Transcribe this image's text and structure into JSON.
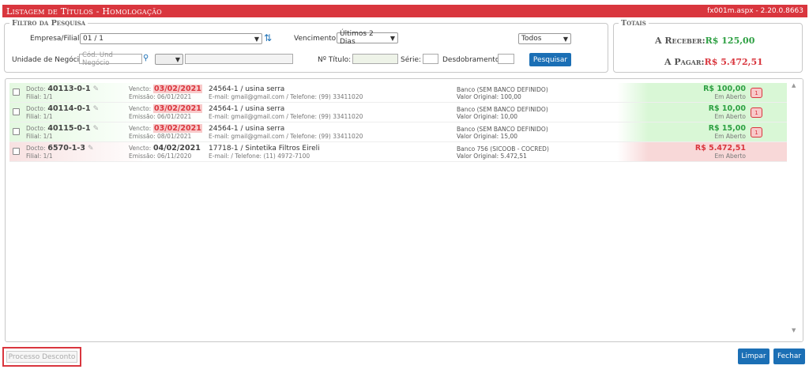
{
  "header": {
    "title": "Listagem de Títulos  - Homologação",
    "version": "fx001m.aspx - 2.20.0.8663"
  },
  "filtro": {
    "legend": "Filtro da Pesquisa",
    "empresa_label": "Empresa/Filial:",
    "empresa_value": "01 / 1",
    "vencimento_label": "Vencimento:",
    "vencimento_value": "Últimos 2 Dias",
    "todos_value": "Todos",
    "unidade_label": "Unidade de Negócio:",
    "unidade_placeholder": "Cód. Und Negócio",
    "titulo_label": "Nº Título:",
    "serie_label": "Série:",
    "desdobramento_label": "Desdobramento:",
    "pesquisar": "Pesquisar"
  },
  "totais": {
    "legend": "Totais",
    "receber_label": "A Receber:",
    "receber_value": "R$ 125,00",
    "pagar_label": "A Pagar:",
    "pagar_value": "R$ 5.472,51"
  },
  "rows": [
    {
      "docto_label": "Docto:",
      "docto": "40113-0-1",
      "filial": "Filial: 1/1",
      "vencto_label": "Vencto:",
      "vencto": "03/02/2021",
      "emissao": "Emissão: 06/01/2021",
      "cliente": "24564-1 / usina serra",
      "contato": "E-mail: gmail@gmail.com / Telefone: (99) 33411020",
      "banco": "Banco (SEM BANCO DEFINIDO)",
      "original": "Valor Original: 100,00",
      "valor": "R$ 100,00",
      "status": "Em Aberto",
      "badge": "1"
    },
    {
      "docto_label": "Docto:",
      "docto": "40114-0-1",
      "filial": "Filial: 1/1",
      "vencto_label": "Vencto:",
      "vencto": "03/02/2021",
      "emissao": "Emissão: 06/01/2021",
      "cliente": "24564-1 / usina serra",
      "contato": "E-mail: gmail@gmail.com / Telefone: (99) 33411020",
      "banco": "Banco (SEM BANCO DEFINIDO)",
      "original": "Valor Original: 10,00",
      "valor": "R$ 10,00",
      "status": "Em Aberto",
      "badge": "1"
    },
    {
      "docto_label": "Docto:",
      "docto": "40115-0-1",
      "filial": "Filial: 1/1",
      "vencto_label": "Vencto:",
      "vencto": "03/02/2021",
      "emissao": "Emissão: 08/01/2021",
      "cliente": "24564-1 / usina serra",
      "contato": "E-mail: gmail@gmail.com / Telefone: (99) 33411020",
      "banco": "Banco (SEM BANCO DEFINIDO)",
      "original": "Valor Original: 15,00",
      "valor": "R$ 15,00",
      "status": "Em Aberto",
      "badge": "1"
    },
    {
      "docto_label": "Docto:",
      "docto": "6570-1-3",
      "filial": "Filial: 1/1",
      "vencto_label": "Vencto:",
      "vencto": "04/02/2021",
      "emissao": "Emissão: 06/11/2020",
      "cliente": "17718-1 / Sintetika Filtros Eireli",
      "contato": "E-mail: / Telefone: (11) 4972-7100",
      "banco": "Banco 756 (SICOOB - COCRED)",
      "original": "Valor Original: 5.472,51",
      "valor": "R$ 5.472,51",
      "status": "Em Aberto",
      "badge": ""
    }
  ],
  "footer": {
    "processo": "Processo Desconto",
    "limpar": "Limpar",
    "fechar": "Fechar"
  }
}
